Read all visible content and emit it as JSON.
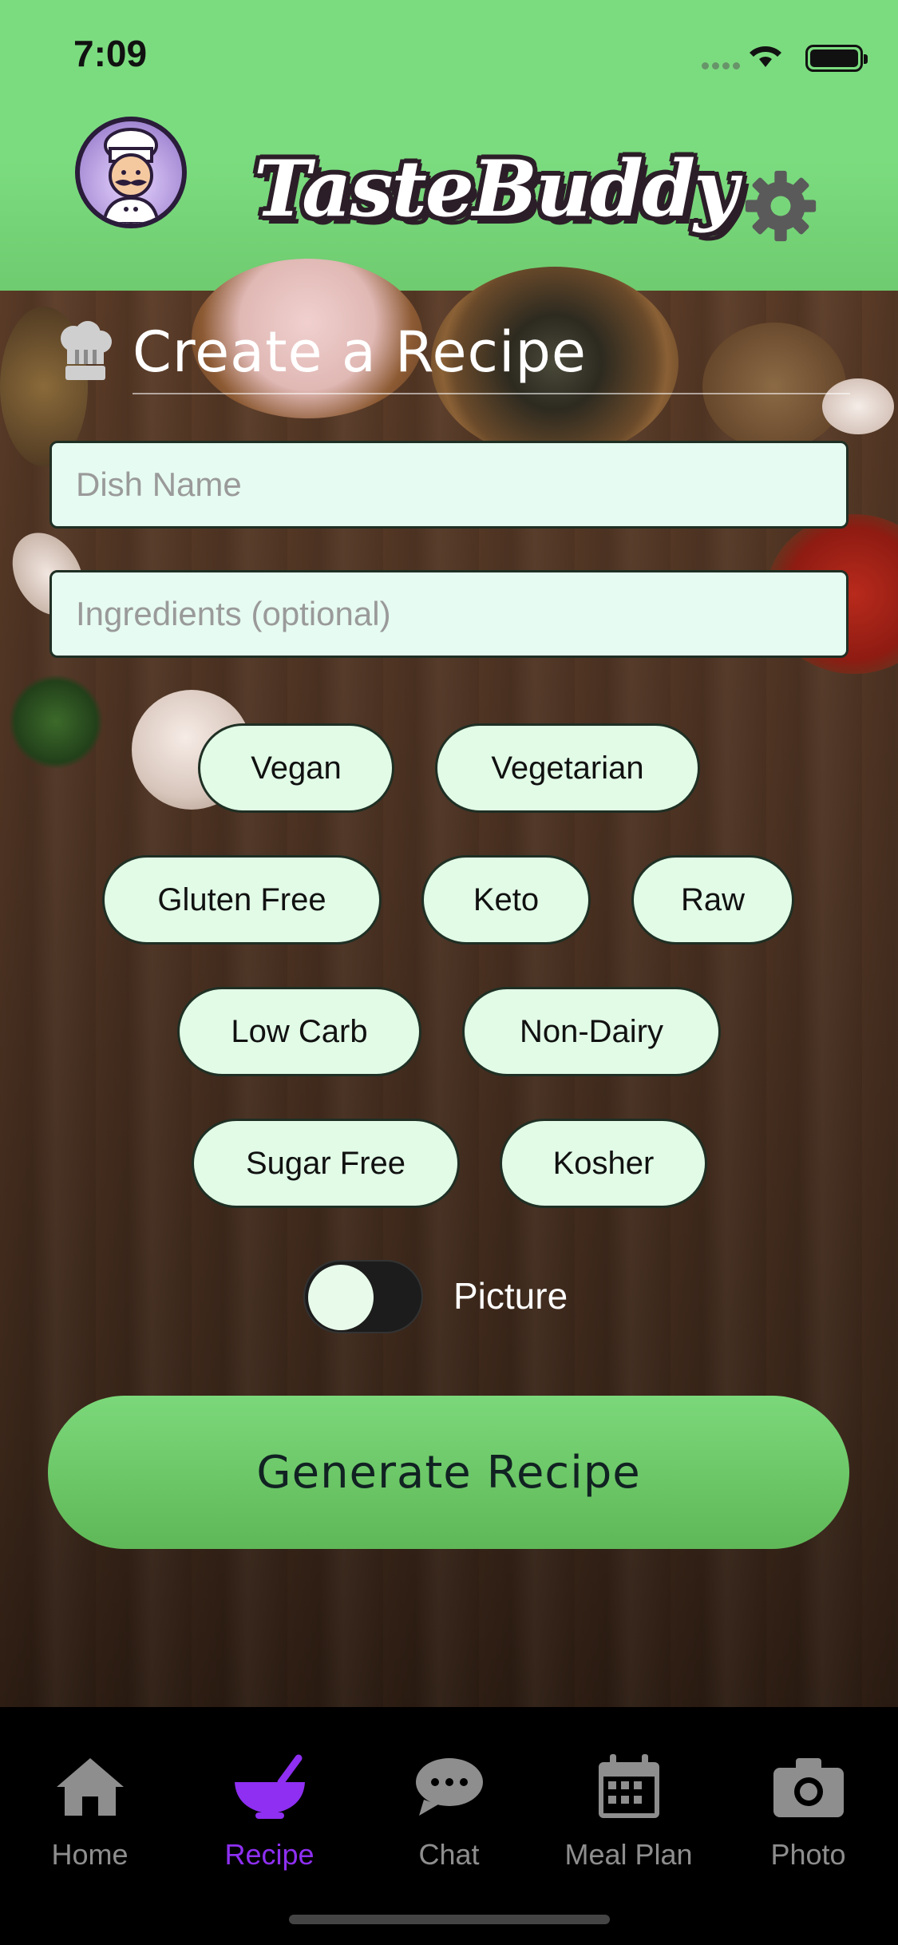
{
  "status_bar": {
    "time": "7:09"
  },
  "header": {
    "app_name": "TasteBuddy"
  },
  "page": {
    "title": "Create a Recipe"
  },
  "form": {
    "dish_placeholder": "Dish Name",
    "ingredients_placeholder": "Ingredients (optional)"
  },
  "chips": [
    {
      "label": "Vegan"
    },
    {
      "label": "Vegetarian"
    },
    {
      "label": "Gluten Free"
    },
    {
      "label": "Keto"
    },
    {
      "label": "Raw"
    },
    {
      "label": "Low Carb"
    },
    {
      "label": "Non-Dairy"
    },
    {
      "label": "Sugar Free"
    },
    {
      "label": "Kosher"
    }
  ],
  "picture_toggle": {
    "label": "Picture",
    "on": false
  },
  "generate_button": {
    "label": "Generate Recipe"
  },
  "tabs": [
    {
      "label": "Home",
      "icon": "home-icon",
      "active": false
    },
    {
      "label": "Recipe",
      "icon": "bowl-icon",
      "active": true
    },
    {
      "label": "Chat",
      "icon": "chat-icon",
      "active": false
    },
    {
      "label": "Meal Plan",
      "icon": "calendar-icon",
      "active": false
    },
    {
      "label": "Photo",
      "icon": "camera-icon",
      "active": false
    }
  ],
  "colors": {
    "header_green": "#7bdc7f",
    "chip_fill": "#e1fbe6",
    "active_tab": "#8e2ff2",
    "button_green": "#6cc868"
  }
}
